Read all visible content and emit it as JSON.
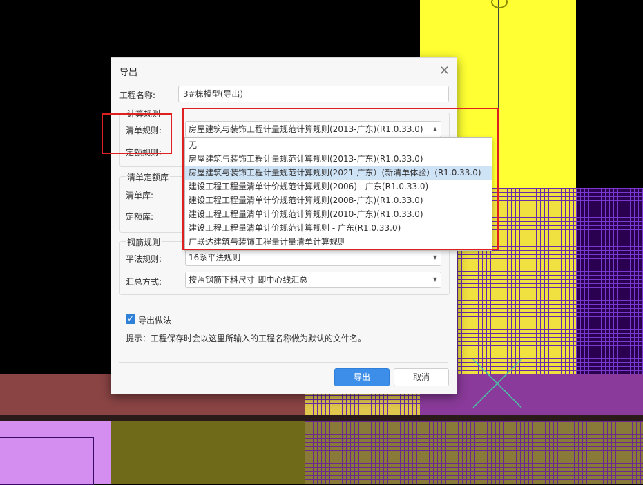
{
  "dialog": {
    "title": "导出",
    "project_name_label": "工程名称:",
    "project_name_value": "3#栋模型(导出)",
    "calc_rules_group": "计算规则",
    "bill_rule_label": "清单规则:",
    "bill_rule_selected": "房屋建筑与装饰工程计量规范计算规则(2013-广东)(R1.0.33.0)",
    "quota_rule_label": "定额规则:",
    "library_group": "清单定额库",
    "bill_library_label": "清单库:",
    "quota_library_label": "定额库:",
    "rebar_group": "钢筋规则",
    "flat_rule_label": "平法规则:",
    "flat_rule_value": "16系平法规则",
    "summary_label": "汇总方式:",
    "summary_value": "按照钢筋下料尺寸-即中心线汇总",
    "export_method_label": "导出做法",
    "hint": "提示：工程保存时会以这里所输入的工程名称做为默认的文件名。",
    "export_button": "导出",
    "cancel_button": "取消"
  },
  "dropdown": {
    "options": [
      "无",
      "房屋建筑与装饰工程计量规范计算规则(2013-广东)(R1.0.33.0)",
      "房屋建筑与装饰工程计量规范计算规则(2021-广东）(新清单体验）(R1.0.33.0)",
      "建设工程工程量清单计价规范计算规则(2006)—广东(R1.0.33.0)",
      "建设工程工程量清单计价规范计算规则(2008-广东)(R1.0.33.0)",
      "建设工程工程量清单计价规范计算规则(2010-广东)(R1.0.33.0)",
      "建设工程工程量清单计价规范计算规则 - 广东(R1.0.33.0)",
      "广联达建筑与装饰工程量计量清单计算规则"
    ],
    "highlighted_index": 2
  },
  "colors": {
    "primary": "#3d8ee8",
    "highlight": "#e02020",
    "yellow": "#ffff33"
  }
}
